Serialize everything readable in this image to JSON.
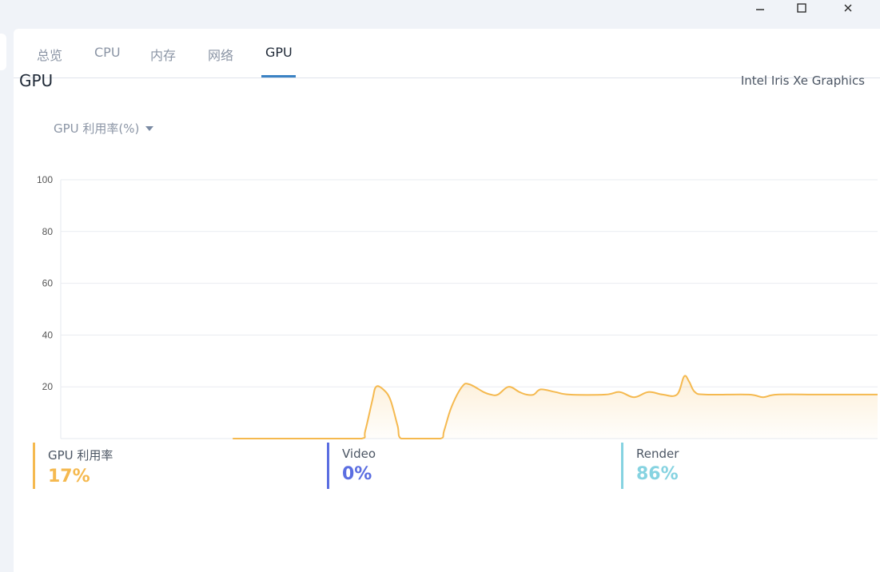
{
  "window": {
    "minimize_icon": "minimize-icon",
    "maximize_icon": "maximize-icon",
    "close_icon": "close-icon"
  },
  "tabs": [
    {
      "label": "总览",
      "active": false
    },
    {
      "label": "CPU",
      "active": false
    },
    {
      "label": "内存",
      "active": false
    },
    {
      "label": "网络",
      "active": false
    },
    {
      "label": "GPU",
      "active": true
    }
  ],
  "header": {
    "title": "GPU",
    "device": "Intel Iris Xe Graphics"
  },
  "metric_select": {
    "value": "GPU 利用率(%)",
    "icon": "caret-down-icon"
  },
  "legend": [
    {
      "label": "GPU 利用率",
      "value": "17%",
      "color": "#f5b94f"
    },
    {
      "label": "Video",
      "value": "0%",
      "color": "#5b6ee1"
    },
    {
      "label": "Render",
      "value": "86%",
      "color": "#86d3e1"
    }
  ],
  "chart_data": {
    "type": "line",
    "title": "",
    "xlabel": "",
    "ylabel": "",
    "ylim": [
      0,
      100
    ],
    "yticks": [
      "100",
      "80",
      "60",
      "40",
      "20"
    ],
    "grid": true,
    "series": [
      {
        "name": "GPU 利用率",
        "color": "#f5b94f",
        "points": [
          [
            0,
            0
          ],
          [
            8,
            0
          ],
          [
            14,
            0
          ],
          [
            18,
            0
          ],
          [
            18.5,
            3
          ],
          [
            19.5,
            15
          ],
          [
            20,
            20
          ],
          [
            21,
            19
          ],
          [
            22,
            15
          ],
          [
            23,
            5
          ],
          [
            23.5,
            0
          ],
          [
            26,
            0
          ],
          [
            29,
            0
          ],
          [
            29.5,
            3
          ],
          [
            30.5,
            12
          ],
          [
            32,
            20
          ],
          [
            33,
            21
          ],
          [
            35,
            18
          ],
          [
            36,
            17
          ],
          [
            37,
            17
          ],
          [
            38.5,
            20
          ],
          [
            40,
            18
          ],
          [
            41,
            17
          ],
          [
            42,
            17
          ],
          [
            43,
            19
          ],
          [
            45,
            18
          ],
          [
            47,
            17
          ],
          [
            52,
            17
          ],
          [
            54,
            18
          ],
          [
            56,
            16
          ],
          [
            58,
            18
          ],
          [
            60,
            17
          ],
          [
            62,
            17
          ],
          [
            63,
            24
          ],
          [
            63.7,
            22
          ],
          [
            64.5,
            18
          ],
          [
            66,
            17
          ],
          [
            72,
            17
          ],
          [
            74,
            16
          ],
          [
            76,
            17
          ],
          [
            82,
            17
          ],
          [
            90,
            17
          ]
        ],
        "x_min": -24,
        "x_max": 90
      }
    ]
  }
}
